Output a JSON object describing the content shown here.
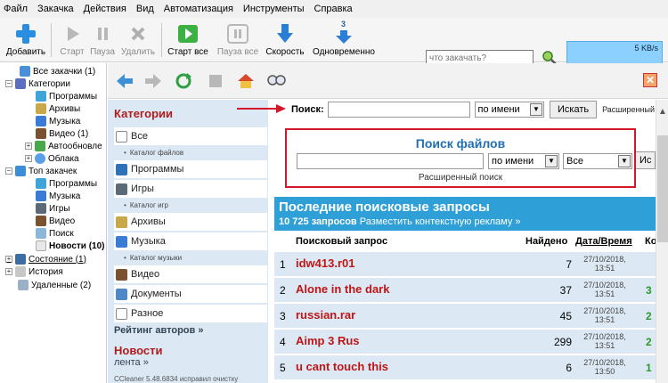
{
  "menu": [
    "Файл",
    "Закачка",
    "Действия",
    "Вид",
    "Автоматизация",
    "Инструменты",
    "Справка"
  ],
  "toolbar": {
    "add": "Добавить",
    "start": "Старт",
    "pause": "Пауза",
    "delete": "Удалить",
    "start_all": "Старт все",
    "pause_all": "Пауза все",
    "speed": "Скорость",
    "simultaneous": "Одновременно",
    "simultaneous_count": "3",
    "search_placeholder": "что закачать?",
    "speed_readout": "5 KB/s"
  },
  "tree": [
    {
      "label": "Все закачки (1)"
    },
    {
      "label": "Категории"
    },
    {
      "label": "Программы"
    },
    {
      "label": "Архивы"
    },
    {
      "label": "Музыка"
    },
    {
      "label": "Видео (1)"
    },
    {
      "label": "Автообновле"
    },
    {
      "label": "Облака"
    },
    {
      "label": "Топ закачек"
    },
    {
      "label": "Программы"
    },
    {
      "label": "Музыка"
    },
    {
      "label": "Игры"
    },
    {
      "label": "Видео"
    },
    {
      "label": "Поиск"
    },
    {
      "label": "Новости (10)"
    },
    {
      "label": "Состояние (1)"
    },
    {
      "label": "История"
    },
    {
      "label": "Удаленные (2)"
    }
  ],
  "categories": {
    "title": "Категории",
    "items": [
      {
        "label": "Все",
        "sub": "Каталог файлов"
      },
      {
        "label": "Программы",
        "sub": ""
      },
      {
        "label": "Игры",
        "sub": "Каталог игр"
      },
      {
        "label": "Архивы",
        "sub": ""
      },
      {
        "label": "Музыка",
        "sub": "Каталог музыки"
      },
      {
        "label": "Видео",
        "sub": ""
      },
      {
        "label": "Документы",
        "sub": ""
      },
      {
        "label": "Разное",
        "sub": ""
      }
    ],
    "rating": "Рейтинг авторов »",
    "news_title": "Новости",
    "news_sub": "лента »",
    "news_item": "CCleaner 5.48.6834 исправил очистку"
  },
  "search_bar": {
    "label": "Поиск:",
    "mode": "по имени",
    "button": "Искать",
    "advanced": "Расширенный"
  },
  "search_box": {
    "title": "Поиск файлов",
    "mode": "по имени",
    "scope": "Все",
    "button": "Ис",
    "advanced": "Расширенный поиск"
  },
  "recent": {
    "title": "Последние поисковые запросы",
    "count": "10 725 запросов",
    "ad_link": "Разместить контекстную рекламу »",
    "columns": {
      "query": "Поисковый запрос",
      "found": "Найдено",
      "date": "Дата/Время",
      "ko": "Ко"
    },
    "rows": [
      {
        "n": "1",
        "q": "idw413.r01",
        "c": "7",
        "d1": "27/10/2018,",
        "d2": "13:51",
        "k": ""
      },
      {
        "n": "2",
        "q": "Alone in the dark",
        "c": "37",
        "d1": "27/10/2018,",
        "d2": "13:51",
        "k": "3"
      },
      {
        "n": "3",
        "q": "russian.rar",
        "c": "45",
        "d1": "27/10/2018,",
        "d2": "13:51",
        "k": "2"
      },
      {
        "n": "4",
        "q": "Aimp 3 Rus",
        "c": "299",
        "d1": "27/10/2018,",
        "d2": "13:51",
        "k": "2"
      },
      {
        "n": "5",
        "q": "u cant touch this",
        "c": "6",
        "d1": "27/10/2018,",
        "d2": "13:50",
        "k": "1"
      }
    ]
  }
}
